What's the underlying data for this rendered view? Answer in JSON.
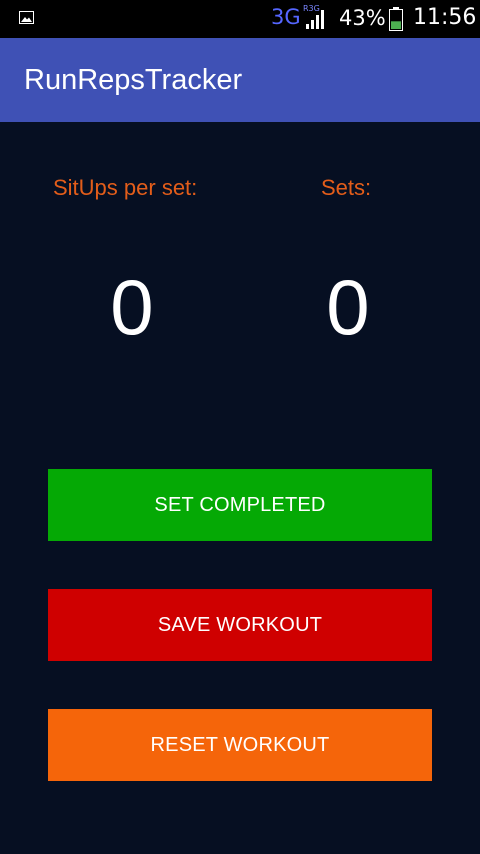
{
  "status_bar": {
    "network_type": "3G",
    "network_sub": "R3G",
    "battery_percent": "43%",
    "time": "11:56",
    "icons": [
      "gallery-icon",
      "signal-icon",
      "battery-icon"
    ],
    "battery_level": 0.43,
    "colors": {
      "network": "#5566ff",
      "battery_fill": "#4caf50"
    }
  },
  "app_bar": {
    "title": "RunRepsTracker",
    "color": "#3f51b5"
  },
  "counters": {
    "reps_label": "SitUps per set:",
    "sets_label": "Sets:",
    "reps_value": "0",
    "sets_value": "0",
    "label_color": "#e35d1a"
  },
  "buttons": {
    "set_completed": "SET COMPLETED",
    "save_workout": "SAVE WORKOUT",
    "reset_workout": "RESET WORKOUT",
    "colors": {
      "set_completed": "#05a905",
      "save_workout": "#cf0000",
      "reset_workout": "#f5650a"
    }
  },
  "background_color": "#060f22"
}
